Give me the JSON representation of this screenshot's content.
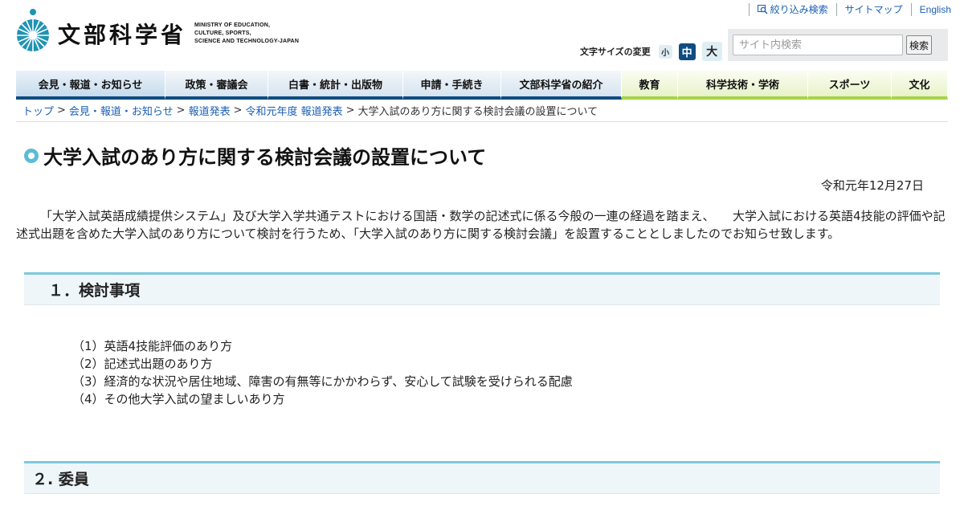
{
  "header": {
    "logo_jp": "文部科学省",
    "logo_en": [
      "MINISTRY OF EDUCATION,",
      "CULTURE, SPORTS,",
      "SCIENCE AND TECHNOLOGY-JAPAN"
    ],
    "links": {
      "refine_search": "絞り込み検索",
      "sitemap": "サイトマップ",
      "english": "English"
    },
    "font_size": {
      "label": "文字サイズの変更",
      "small": "小",
      "medium": "中",
      "large": "大",
      "selected": "中"
    },
    "search": {
      "placeholder": "サイト内検索",
      "button": "検索"
    }
  },
  "nav": {
    "items": [
      "会見・報道・お知らせ",
      "政策・審議会",
      "白書・統計・出版物",
      "申請・手続き",
      "文部科学省の紹介",
      "教育",
      "科学技術・学術",
      "スポーツ",
      "文化"
    ]
  },
  "breadcrumb": {
    "items": [
      "トップ",
      "会見・報道・お知らせ",
      "報道発表",
      "令和元年度 報道発表"
    ],
    "current": "大学入試のあり方に関する検討会議の設置について"
  },
  "main": {
    "title": "大学入試のあり方に関する検討会議の設置について",
    "date": "令和元年12月27日",
    "intro": "「大学入試英語成績提供システム」及び大学入学共通テストにおける国語・数学の記述式に係る今般の一連の経過を踏まえ、　　大学入試における英語4技能の評価や記述式出題を含めた大学入試のあり方について検討を行うため、「大学入試のあり方に関する検討会議」を設置することとしましたのでお知らせ致します。",
    "section1": {
      "heading": "１．検討事項",
      "items": [
        "（1）英語4技能評価のあり方",
        "（2）記述式出題のあり方",
        "（3）経済的な状況や居住地域、障害の有無等にかかわらず、安心して試験を受けられる配慮",
        "（4）その他大学入試の望ましいあり方"
      ]
    },
    "section2": {
      "heading": "２. 委員"
    }
  },
  "colors": {
    "nav_blue_accent": "#0f4c81",
    "nav_green_accent": "#a8d34a",
    "section_border": "#7ec8da",
    "link": "#1a5fb4"
  }
}
